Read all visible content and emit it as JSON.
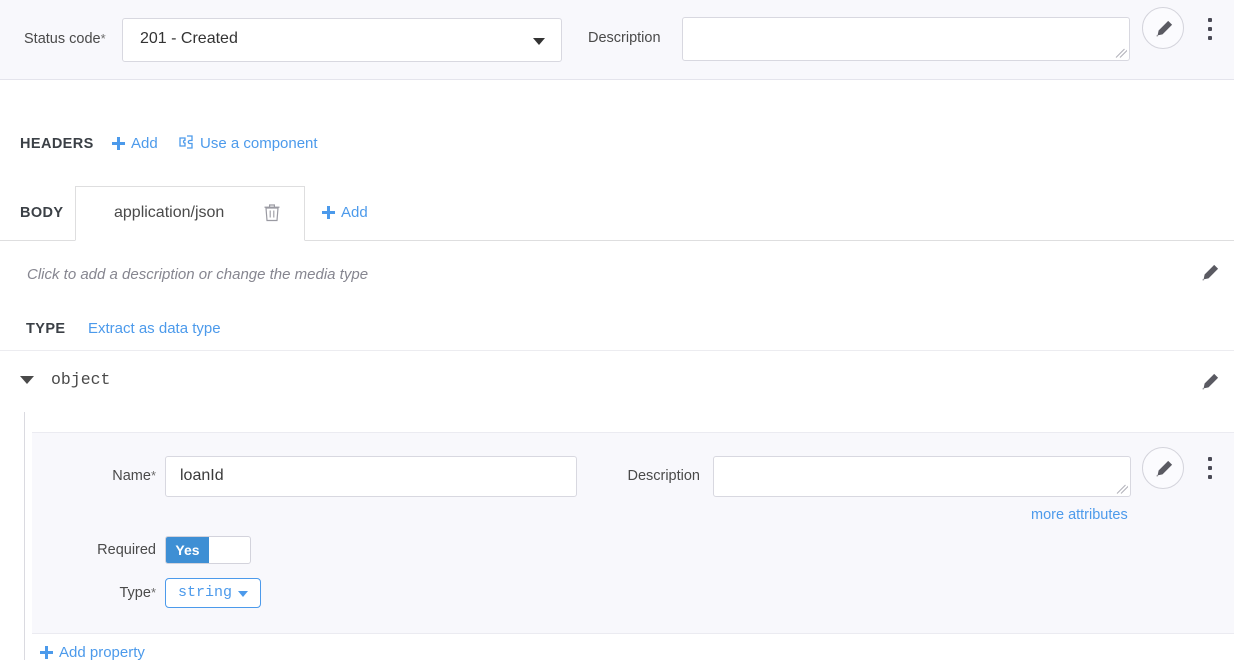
{
  "status_bar": {
    "label": "Status code",
    "required_marker": "*",
    "selected_value": "201 - Created",
    "description_label": "Description",
    "description_value": "",
    "description_placeholder": "",
    "edit_icon": "pencil-icon",
    "menu_icon": "kebab-menu-icon"
  },
  "headers_section": {
    "title": "HEADERS",
    "add_label": "Add",
    "use_component_label": "Use a component",
    "component_icon": "component-icon"
  },
  "body_section": {
    "title": "BODY",
    "tabs": [
      {
        "label": "application/json",
        "active": true,
        "delete_icon": "trash-icon"
      }
    ],
    "add_label": "Add",
    "media_description_placeholder": "Click to add a description or change the media type",
    "edit_icon": "pencil-icon"
  },
  "type_section": {
    "title": "TYPE",
    "extract_link": "Extract as data type",
    "root": {
      "expanded": true,
      "type_name": "object",
      "edit_icon": "pencil-icon",
      "collapse_icon": "triangle-down-icon"
    },
    "property": {
      "name_label": "Name",
      "name_required_marker": "*",
      "name_value": "loanId",
      "description_label": "Description",
      "description_value": "",
      "more_attributes_link": "more attributes",
      "required_label": "Required",
      "required_value": "Yes",
      "type_label": "Type",
      "type_required_marker": "*",
      "type_value": "string",
      "edit_icon": "pencil-icon",
      "menu_icon": "kebab-menu-icon"
    },
    "add_property_label": "Add property"
  },
  "colors": {
    "accent_link": "#4c9aeb",
    "toggle_on": "#3e8fd4",
    "panel_bg": "#f8f8fc",
    "border": "#d8d8e0",
    "text": "#3a3a3a"
  }
}
